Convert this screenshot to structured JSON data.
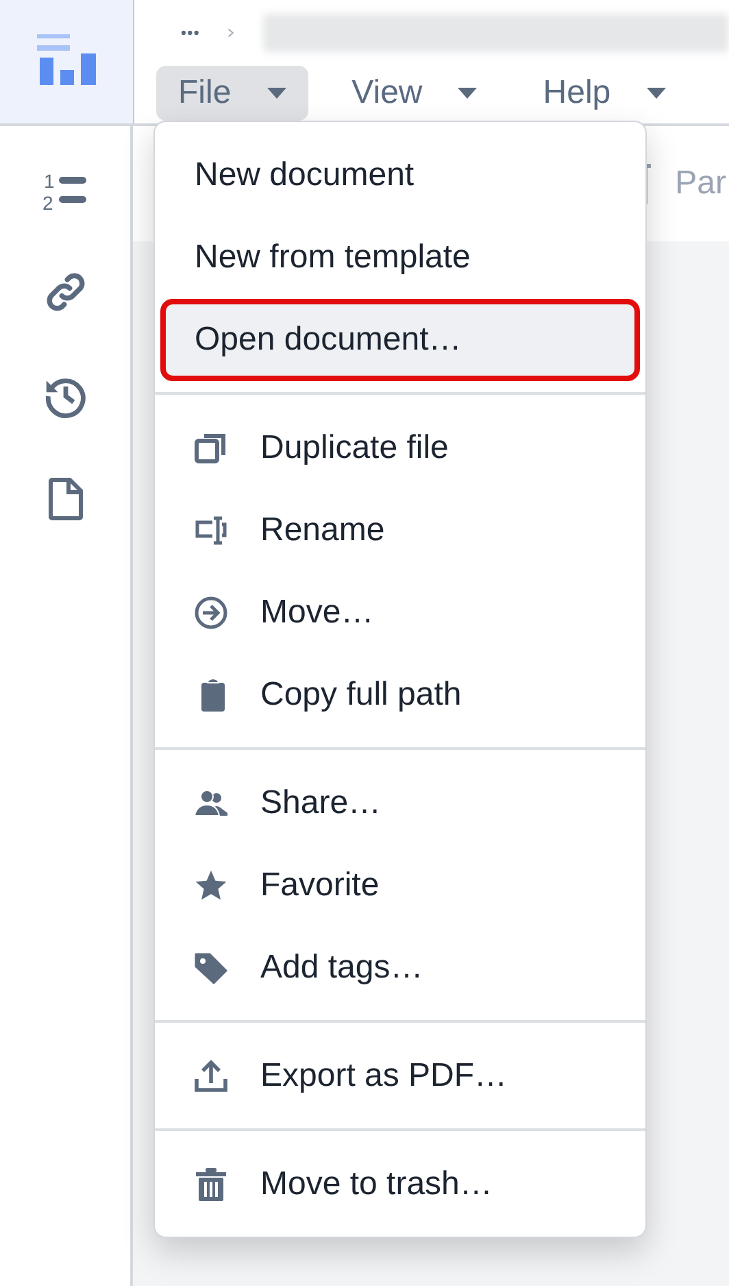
{
  "menubar": [
    {
      "label": "File",
      "selected": true
    },
    {
      "label": "View",
      "selected": false
    },
    {
      "label": "Help",
      "selected": false
    }
  ],
  "sidebar": {
    "list_icon_numbers": [
      "1",
      "2"
    ]
  },
  "toolbar": {
    "text_1": "Par"
  },
  "file_menu": {
    "sections": [
      [
        {
          "label": "New document",
          "highlighted": false
        },
        {
          "label": "New from template",
          "highlighted": false
        },
        {
          "label": "Open document…",
          "highlighted": true
        }
      ],
      [
        {
          "label": "Duplicate file",
          "highlighted": false
        },
        {
          "label": "Rename",
          "highlighted": false
        },
        {
          "label": "Move…",
          "highlighted": false
        },
        {
          "label": "Copy full path",
          "highlighted": false
        }
      ],
      [
        {
          "label": "Share…",
          "highlighted": false
        },
        {
          "label": "Favorite",
          "highlighted": false
        },
        {
          "label": "Add tags…",
          "highlighted": false
        }
      ],
      [
        {
          "label": "Export as PDF…",
          "highlighted": false
        }
      ],
      [
        {
          "label": "Move to trash…",
          "highlighted": false
        }
      ]
    ]
  }
}
